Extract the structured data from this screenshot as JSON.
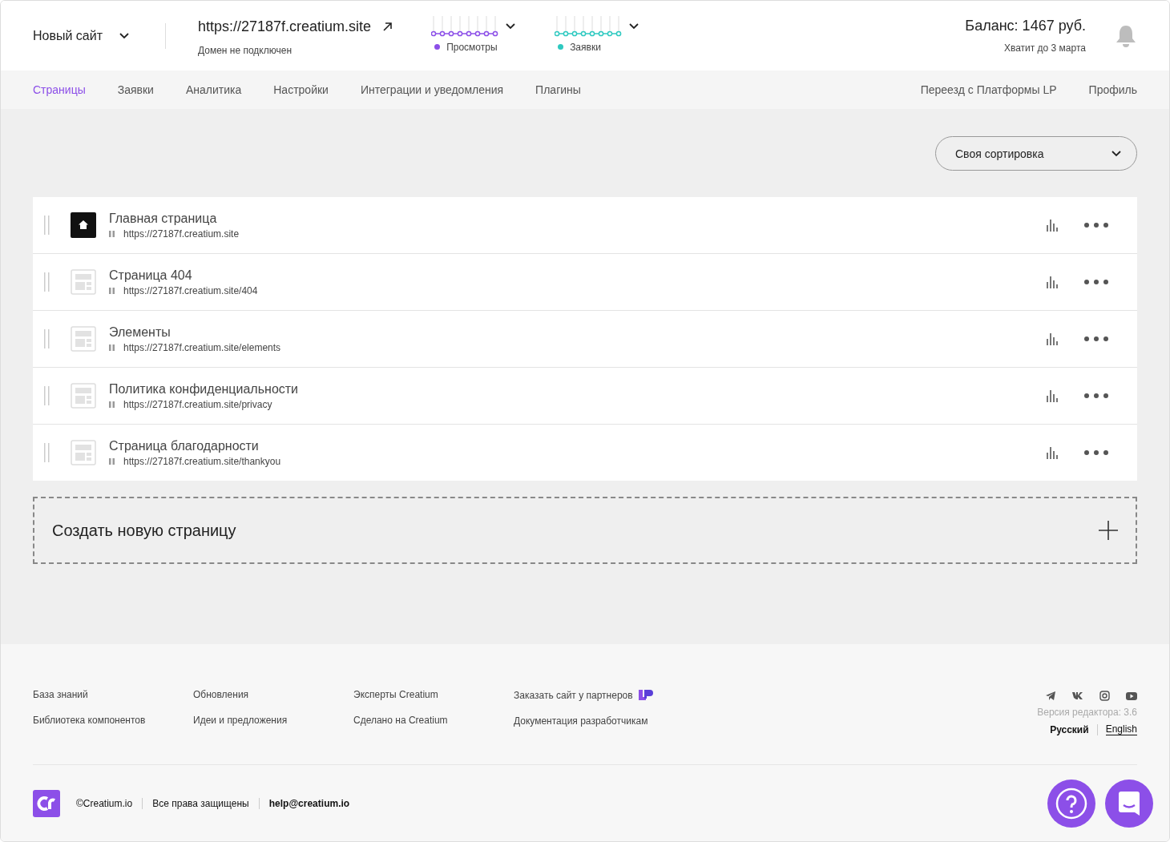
{
  "site": {
    "name": "Новый сайт",
    "url": "https://27187f.creatium.site",
    "domain_status": "Домен не подключен"
  },
  "stats": [
    {
      "label": "Просмотры",
      "color": "#8c4fe8"
    },
    {
      "label": "Заявки",
      "color": "#2ec9c0"
    }
  ],
  "balance": {
    "amount": "Баланс: 1467 руб.",
    "until": "Хватит до 3 марта"
  },
  "nav": {
    "left": [
      {
        "label": "Страницы",
        "selected": true
      },
      {
        "label": "Заявки",
        "selected": false
      },
      {
        "label": "Аналитика",
        "selected": false
      },
      {
        "label": "Настройки",
        "selected": false
      },
      {
        "label": "Интеграции и уведомления",
        "selected": false
      },
      {
        "label": "Плагины",
        "selected": false
      }
    ],
    "right": [
      {
        "label": "Переезд с Платформы LP",
        "selected": false
      },
      {
        "label": "Профиль",
        "selected": false
      }
    ]
  },
  "sort": {
    "value": "Своя сортировка"
  },
  "pages": [
    {
      "kind": "home",
      "title": "Главная страница",
      "url": "https://27187f.creatium.site"
    },
    {
      "kind": "page",
      "title": "Страница 404",
      "url": "https://27187f.creatium.site/404"
    },
    {
      "kind": "page",
      "title": "Элементы",
      "url": "https://27187f.creatium.site/elements"
    },
    {
      "kind": "page",
      "title": "Политика конфиденциальности",
      "url": "https://27187f.creatium.site/privacy"
    },
    {
      "kind": "page",
      "title": "Страница благодарности",
      "url": "https://27187f.creatium.site/thankyou"
    }
  ],
  "create_page": "Создать новую страницу",
  "footer": {
    "columns": [
      [
        "База знаний",
        "Библиотека компонентов"
      ],
      [
        "Обновления",
        "Идеи и предложения"
      ],
      [
        "Эксперты Creatium",
        "Сделано на Creatium"
      ],
      [
        "Заказать сайт у партнеров",
        "Документация разработчикам"
      ]
    ],
    "version": "Версия редактора: 3.6",
    "languages": [
      {
        "label": "Русский",
        "selected": true
      },
      {
        "label": "English",
        "selected": false
      }
    ],
    "copyright": "©Creatium.io",
    "rights": "Все права защищены",
    "email": "help@creatium.io"
  }
}
